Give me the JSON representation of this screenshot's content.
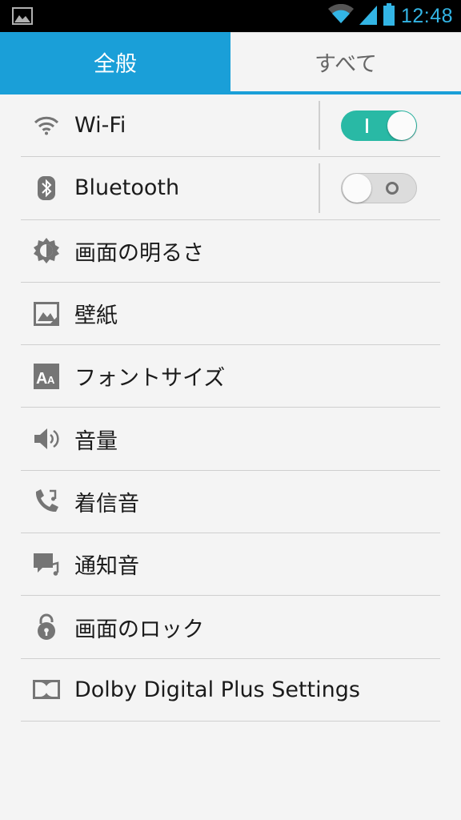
{
  "status_bar": {
    "time": "12:48",
    "accent_color": "#33b5e5"
  },
  "tabs": [
    {
      "label": "全般",
      "active": true
    },
    {
      "label": "すべて",
      "active": false
    }
  ],
  "settings": [
    {
      "icon": "wifi-icon",
      "label": "Wi-Fi",
      "toggle": "on"
    },
    {
      "icon": "bluetooth-icon",
      "label": "Bluetooth",
      "toggle": "off"
    },
    {
      "icon": "brightness-icon",
      "label": "画面の明るさ"
    },
    {
      "icon": "wallpaper-icon",
      "label": "壁紙"
    },
    {
      "icon": "font-size-icon",
      "label": "フォントサイズ"
    },
    {
      "icon": "volume-icon",
      "label": "音量"
    },
    {
      "icon": "ringtone-icon",
      "label": "着信音"
    },
    {
      "icon": "notification-sound-icon",
      "label": "通知音"
    },
    {
      "icon": "lock-icon",
      "label": "画面のロック"
    },
    {
      "icon": "dolby-icon",
      "label": "Dolby Digital Plus Settings"
    }
  ],
  "colors": {
    "tab_active": "#1a9fd8",
    "switch_on": "#29b9a5",
    "icon_gray": "#757575"
  }
}
